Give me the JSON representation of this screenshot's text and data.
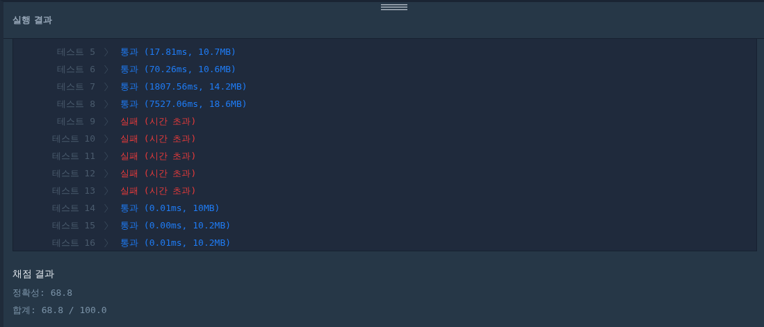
{
  "panel": {
    "title": "실행 결과"
  },
  "tests": [
    {
      "label": "테스트 5",
      "kind": "pass",
      "status": "통과",
      "detail": "(17.81ms, 10.7MB)"
    },
    {
      "label": "테스트 6",
      "kind": "pass",
      "status": "통과",
      "detail": "(70.26ms, 10.6MB)"
    },
    {
      "label": "테스트 7",
      "kind": "pass",
      "status": "통과",
      "detail": "(1807.56ms, 14.2MB)"
    },
    {
      "label": "테스트 8",
      "kind": "pass",
      "status": "통과",
      "detail": "(7527.06ms, 18.6MB)"
    },
    {
      "label": "테스트 9",
      "kind": "fail",
      "status": "실패",
      "detail": "(시간 초과)"
    },
    {
      "label": "테스트 10",
      "kind": "fail",
      "status": "실패",
      "detail": "(시간 초과)"
    },
    {
      "label": "테스트 11",
      "kind": "fail",
      "status": "실패",
      "detail": "(시간 초과)"
    },
    {
      "label": "테스트 12",
      "kind": "fail",
      "status": "실패",
      "detail": "(시간 초과)"
    },
    {
      "label": "테스트 13",
      "kind": "fail",
      "status": "실패",
      "detail": "(시간 초과)"
    },
    {
      "label": "테스트 14",
      "kind": "pass",
      "status": "통과",
      "detail": "(0.01ms, 10MB)"
    },
    {
      "label": "테스트 15",
      "kind": "pass",
      "status": "통과",
      "detail": "(0.00ms, 10.2MB)"
    },
    {
      "label": "테스트 16",
      "kind": "pass",
      "status": "통과",
      "detail": "(0.01ms, 10.2MB)"
    }
  ],
  "grading": {
    "title": "채점 결과",
    "lines": [
      "정확성: 68.8",
      "합계: 68.8 / 100.0"
    ]
  }
}
